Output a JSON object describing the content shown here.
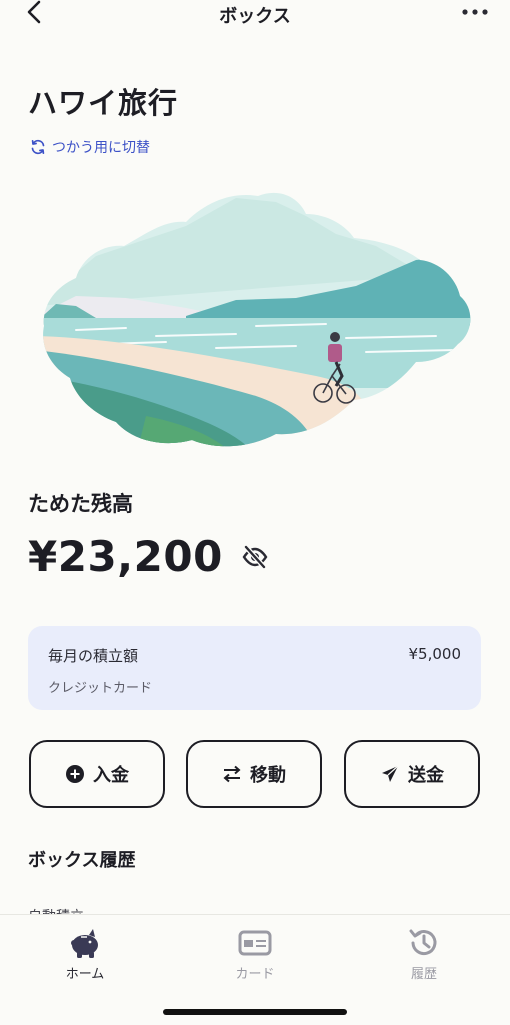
{
  "header": {
    "title": "ボックス"
  },
  "box": {
    "name": "ハワイ旅行",
    "switch_label": "つかう用に切替"
  },
  "balance": {
    "label": "ためた残高",
    "amount": "¥23,200"
  },
  "savings": {
    "title": "毎月の積立額",
    "amount": "¥5,000",
    "method": "クレジットカード"
  },
  "actions": {
    "deposit": "入金",
    "move": "移動",
    "send": "送金"
  },
  "history": {
    "title": "ボックス履歴",
    "first_item": "自動積立"
  },
  "tabs": [
    {
      "label": "ホーム",
      "icon": "piggy-bank-icon"
    },
    {
      "label": "カード",
      "icon": "card-icon"
    },
    {
      "label": "履歴",
      "icon": "history-clock-icon"
    }
  ],
  "colors": {
    "accent": "#3d52c7",
    "card_bg": "#e9edfb",
    "text": "#1d1d24"
  }
}
